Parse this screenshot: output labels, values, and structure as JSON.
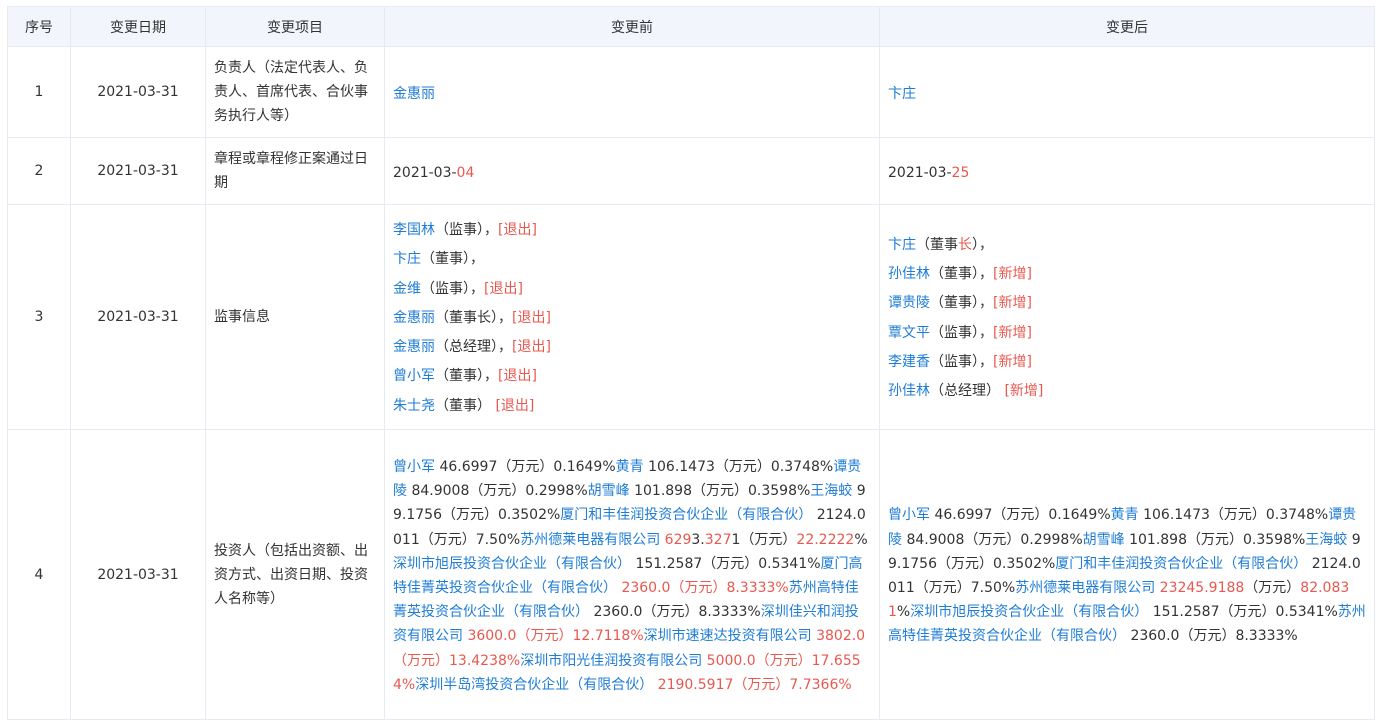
{
  "headers": [
    "序号",
    "变更日期",
    "变更项目",
    "变更前",
    "变更后"
  ],
  "rows": [
    {
      "no": "1",
      "date": "2021-03-31",
      "item": "负责人（法定代表人、负责人、首席代表、合伙事务执行人等）",
      "before_name": "金惠丽",
      "after_name": "卞庄"
    },
    {
      "no": "2",
      "date": "2021-03-31",
      "item": "章程或章程修正案通过日期",
      "before_prefix": "2021-03-",
      "before_changed": "04",
      "after_prefix": "2021-03-",
      "after_changed": "25"
    },
    {
      "no": "3",
      "date": "2021-03-31",
      "item": "监事信息",
      "before": [
        {
          "name": "李国林",
          "role": "（监事）",
          "sep": "，",
          "tag": "[退出]"
        },
        {
          "name": "卞庄",
          "role": "（董事）",
          "sep": "，",
          "tag": ""
        },
        {
          "name": "金维",
          "role": "（监事）",
          "sep": "，",
          "tag": "[退出]"
        },
        {
          "name": "金惠丽",
          "role": "（董事长）",
          "sep": "，",
          "tag": "[退出]"
        },
        {
          "name": "金惠丽",
          "role": "（总经理）",
          "sep": "，",
          "tag": "[退出]"
        },
        {
          "name": "曾小军",
          "role": "（董事）",
          "sep": "，",
          "tag": "[退出]"
        },
        {
          "name": "朱士尧",
          "role": "（董事）",
          "sep": " ",
          "tag": "[退出]"
        }
      ],
      "after": [
        {
          "name": "卞庄",
          "role_pre": "（董事",
          "role_changed": "长",
          "role_post": "）",
          "sep": "，",
          "tag": ""
        },
        {
          "name": "孙佳林",
          "role": "（董事）",
          "sep": "，",
          "tag": "[新增]"
        },
        {
          "name": "谭贵陵",
          "role": "（董事）",
          "sep": "，",
          "tag": "[新增]"
        },
        {
          "name": "覃文平",
          "role": "（监事）",
          "sep": "，",
          "tag": "[新增]"
        },
        {
          "name": "李建香",
          "role": "（监事）",
          "sep": "，",
          "tag": "[新增]"
        },
        {
          "name": "孙佳林",
          "role": "（总经理）",
          "sep": " ",
          "tag": "[新增]"
        }
      ]
    },
    {
      "no": "4",
      "date": "2021-03-31",
      "item": "投资人（包括出资额、出资方式、出资日期、投资人名称等）",
      "before": [
        {
          "name": "曾小军",
          "amount": "46.6997（万元）0.1649%",
          "red": false
        },
        {
          "name": "黄青",
          "amount": "106.1473（万元）0.3748%",
          "red": false
        },
        {
          "name": "谭贵陵",
          "amount": "84.9008（万元）0.2998%",
          "red": false
        },
        {
          "name": "胡雪峰",
          "amount": "101.898（万元）0.3598%",
          "red": false
        },
        {
          "name": "王海蛟",
          "amount": "99.1756（万元）0.3502%",
          "red": false
        },
        {
          "name": "厦门和丰佳润投资合伙企业（有限合伙）",
          "amount": "2124.0011（万元）7.50%",
          "red": false
        },
        {
          "name": "苏州德莱电器有限公司",
          "amount_parts": [
            [
              "629",
              "red"
            ],
            [
              "3.",
              "txt"
            ],
            [
              "327",
              "red"
            ],
            [
              "1（万元）",
              "txt"
            ],
            [
              "22.2222",
              "red"
            ],
            [
              "%",
              "txt"
            ]
          ]
        },
        {
          "name": "深圳市旭辰投资合伙企业（有限合伙）",
          "amount": "151.2587（万元）0.5341%",
          "red": false
        },
        {
          "name": "厦门高特佳菁英投资合伙企业（有限合伙）",
          "amount": "2360.0（万元）8.3333%",
          "red": true
        },
        {
          "name": "苏州高特佳菁英投资合伙企业（有限合伙）",
          "amount": "2360.0（万元）8.3333%",
          "red": false
        },
        {
          "name": "深圳佳兴和润投资有限公司",
          "amount": "3600.0（万元）12.7118%",
          "red": true
        },
        {
          "name": "深圳市速速达投资有限公司",
          "amount": "3802.0（万元）13.4238%",
          "red": true
        },
        {
          "name": "深圳市阳光佳润投资有限公司",
          "amount": "5000.0（万元）17.6554%",
          "red": true
        },
        {
          "name": "深圳半岛湾投资合伙企业（有限合伙）",
          "amount": "2190.5917（万元）7.7366%",
          "red": true
        }
      ],
      "after": [
        {
          "name": "曾小军",
          "amount": "46.6997（万元）0.1649%",
          "red": false
        },
        {
          "name": "黄青",
          "amount": "106.1473（万元）0.3748%",
          "red": false
        },
        {
          "name": "谭贵陵",
          "amount": "84.9008（万元）0.2998%",
          "red": false
        },
        {
          "name": "胡雪峰",
          "amount": "101.898（万元）0.3598%",
          "red": false
        },
        {
          "name": "王海蛟",
          "amount": "99.1756（万元）0.3502%",
          "red": false
        },
        {
          "name": "厦门和丰佳润投资合伙企业（有限合伙）",
          "amount": "2124.0011（万元）7.50%",
          "red": false
        },
        {
          "name": "苏州德莱电器有限公司",
          "amount_parts": [
            [
              "232",
              "red"
            ],
            [
              "45.9",
              "red"
            ],
            [
              "188",
              "red"
            ],
            [
              "（万元）",
              "txt"
            ],
            [
              "82.0831",
              "red"
            ],
            [
              "%",
              "txt"
            ]
          ]
        },
        {
          "name": "深圳市旭辰投资合伙企业（有限合伙）",
          "amount": "151.2587（万元）0.5341%",
          "red": false
        },
        {
          "name": "苏州高特佳菁英投资合伙企业（有限合伙）",
          "amount": "2360.0（万元）8.3333%",
          "red": false
        }
      ]
    }
  ],
  "colors": {
    "link": "#1f7dd6",
    "changed": "#e8584f",
    "header_bg": "#f2f6fc",
    "border": "#e6ebf2"
  }
}
